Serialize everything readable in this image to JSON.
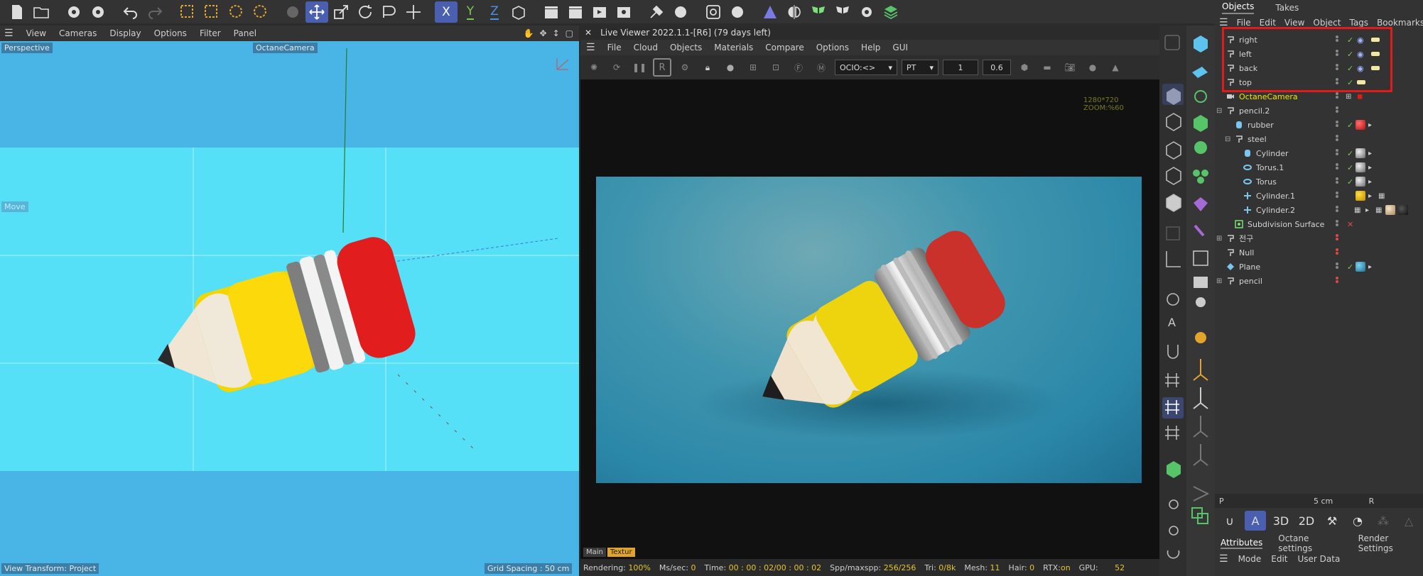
{
  "toolbar": {
    "icons": [
      "file-icon",
      "folder-icon",
      "gear-icon",
      "gear-icon",
      "undo-icon",
      "redo-icon",
      "select-live-icon",
      "select-box-icon",
      "select-lasso-icon",
      "select-poly-icon",
      "gear-icon",
      "move-icon",
      "scale-icon",
      "rotate-icon",
      "transform-icon",
      "axis-icon",
      "x-axis-icon",
      "y-axis-icon",
      "z-axis-icon",
      "coord-icon",
      "clapper-icon",
      "clapper-icon",
      "play-icon",
      "render-settings-icon",
      "tool-icon",
      "gear-icon",
      "snap-icon",
      "gear-icon",
      "octane-icon",
      "symmetry-icon",
      "butterfly-icon",
      "butterfly-icon",
      "gear-icon",
      "layers-icon"
    ],
    "x_label": "X",
    "y_label": "Y",
    "z_label": "Z",
    "colors": {
      "x": "#e04848",
      "y": "#7ac74f",
      "z": "#4d90e8",
      "active": "#4a5fb0"
    }
  },
  "viewport": {
    "menu": [
      "View",
      "Cameras",
      "Display",
      "Options",
      "Filter",
      "Panel"
    ],
    "perspective_label": "Perspective",
    "camera_label": "OctaneCamera",
    "move_label": "Move",
    "view_transform": "View Transform: Project",
    "grid_spacing": "Grid Spacing : 50 cm"
  },
  "live_viewer": {
    "title": "Live Viewer 2022.1.1-[R6] (79 days left)",
    "menu": [
      "File",
      "Cloud",
      "Objects",
      "Materials",
      "Compare",
      "Options",
      "Help",
      "GUI"
    ],
    "ocio_value": "OCIO:<>",
    "kernel_value": "PT",
    "field_1": "1",
    "field_2": "0.6",
    "resolution_text": "1280*720 ZOOM:%60",
    "tabs": [
      "Main",
      "Textur"
    ],
    "status": {
      "rendering_label": "Rendering:",
      "rendering_val": "100%",
      "ms_label": "Ms/sec:",
      "ms_val": "0",
      "time_label": "Time:",
      "time_val": "00 : 00 : 02/00 : 00 : 02",
      "spp_label": "Spp/maxspp:",
      "spp_val": "256/256",
      "tri_label": "Tri:",
      "tri_val": "0/8k",
      "mesh_label": "Mesh:",
      "mesh_val": "11",
      "hair_label": "Hair:",
      "hair_val": "0",
      "rtx_label": "RTX:",
      "rtx_val": "on",
      "gpu_label": "GPU:",
      "gpu_val": "52"
    }
  },
  "object_manager": {
    "tabs": [
      "Objects",
      "Takes"
    ],
    "menu": [
      "File",
      "Edit",
      "View",
      "Object",
      "Tags",
      "Bookmarks"
    ],
    "rows": [
      {
        "name": "right",
        "icon": "light-icon"
      },
      {
        "name": "left",
        "icon": "light-icon"
      },
      {
        "name": "back",
        "icon": "light-icon"
      },
      {
        "name": "top",
        "icon": "light-icon"
      },
      {
        "name": "OctaneCamera",
        "icon": "camera-icon"
      },
      {
        "name": "pencil.2",
        "icon": "null-icon"
      },
      {
        "name": "rubber",
        "icon": "cylinder-icon"
      },
      {
        "name": "steel",
        "icon": "null-icon"
      },
      {
        "name": "Cylinder",
        "icon": "cylinder-icon"
      },
      {
        "name": "Torus.1",
        "icon": "torus-icon"
      },
      {
        "name": "Torus",
        "icon": "torus-icon"
      },
      {
        "name": "Cylinder.1",
        "icon": "cylinder-icon"
      },
      {
        "name": "Cylinder.2",
        "icon": "cylinder-icon"
      },
      {
        "name": "Subdivision Surface",
        "icon": "subdivision-icon"
      },
      {
        "name": "전구",
        "icon": "null-icon"
      },
      {
        "name": "Null",
        "icon": "null-icon"
      },
      {
        "name": "Plane",
        "icon": "plane-icon"
      },
      {
        "name": "pencil",
        "icon": "null-icon"
      }
    ],
    "p_label": "P",
    "p_value": "5 cm",
    "r_label": "R",
    "buttons": [
      "A",
      "3D",
      "2D"
    ],
    "attr_tabs": [
      "Attributes",
      "Octane settings",
      "Render Settings"
    ],
    "attr_menu": [
      "Mode",
      "Edit",
      "User Data"
    ],
    "highlight_color": "#e01b1b",
    "camera_color": "#f3e200"
  }
}
